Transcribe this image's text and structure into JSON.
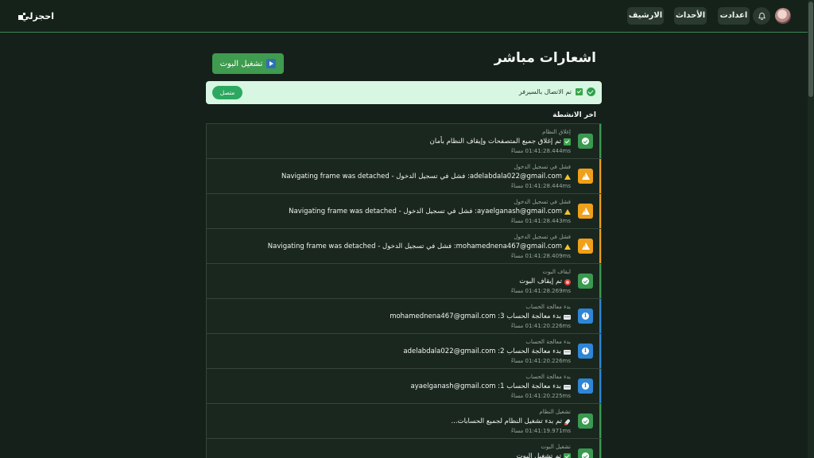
{
  "nav": {
    "logo_text": "احجزلي",
    "archive_label": "الارشيف",
    "events_label": "الأحداث",
    "settings_label": "اعدادت"
  },
  "page": {
    "title": "اشعارات مباشر",
    "run_bot_label": "تشغيل البوت"
  },
  "connection": {
    "text": "تم الاتصال بالسيرفر",
    "status": "متصل"
  },
  "activity": {
    "heading": "اخر الانشطة",
    "items": [
      {
        "category": "إغلاق النظام",
        "message": "تم إغلاق جميع المتصفحات وإيقاف النظام بأمان",
        "time": "01:41:28.444ms مساءً",
        "type": "success",
        "icon": "check-box-icon"
      },
      {
        "category": "فشل في تسجيل الدخول",
        "message": "adelabdala022@gmail.com: فشل في تسجيل الدخول - Navigating frame was detached",
        "time": "01:41:28.444ms مساءً",
        "type": "warning",
        "icon": "warning-icon"
      },
      {
        "category": "فشل في تسجيل الدخول",
        "message": "ayaelganash@gmail.com: فشل في تسجيل الدخول - Navigating frame was detached",
        "time": "01:41:28.443ms مساءً",
        "type": "warning",
        "icon": "warning-icon"
      },
      {
        "category": "فشل في تسجيل الدخول",
        "message": "mohamednena467@gmail.com: فشل في تسجيل الدخول - Navigating frame was detached",
        "time": "01:41:28.409ms مساءً",
        "type": "warning",
        "icon": "warning-icon"
      },
      {
        "category": "ايقاف البوت",
        "message": "تم إيقاف البوت",
        "time": "01:41:28.269ms مساءً",
        "type": "success",
        "icon": "stop-icon"
      },
      {
        "category": "بدء معالجة الحساب",
        "message": "بدء معالجة الحساب 3: mohamednena467@gmail.com",
        "time": "01:41:20.226ms مساءً",
        "type": "info",
        "icon": "card-icon"
      },
      {
        "category": "بدء معالجة الحساب",
        "message": "بدء معالجة الحساب 2: adelabdala022@gmail.com",
        "time": "01:41:20.226ms مساءً",
        "type": "info",
        "icon": "card-icon"
      },
      {
        "category": "بدء معالجة الحساب",
        "message": "بدء معالجة الحساب 1: ayaelganash@gmail.com",
        "time": "01:41:20.225ms مساءً",
        "type": "info",
        "icon": "card-icon"
      },
      {
        "category": "تشغيل النظام",
        "message": "تم بدء تشغيل النظام لجميع الحسابات...",
        "time": "01:41:19.971ms مساءً",
        "type": "success",
        "icon": "rocket-icon"
      },
      {
        "category": "تشغيل البوت",
        "message": "تم تشغيل البوت",
        "time": "",
        "type": "success",
        "icon": "check-box-icon"
      }
    ]
  },
  "colors": {
    "success": "#3a9a50",
    "warning": "#f0a01a",
    "info": "#2e86d6",
    "accent": "#3d8a55"
  }
}
